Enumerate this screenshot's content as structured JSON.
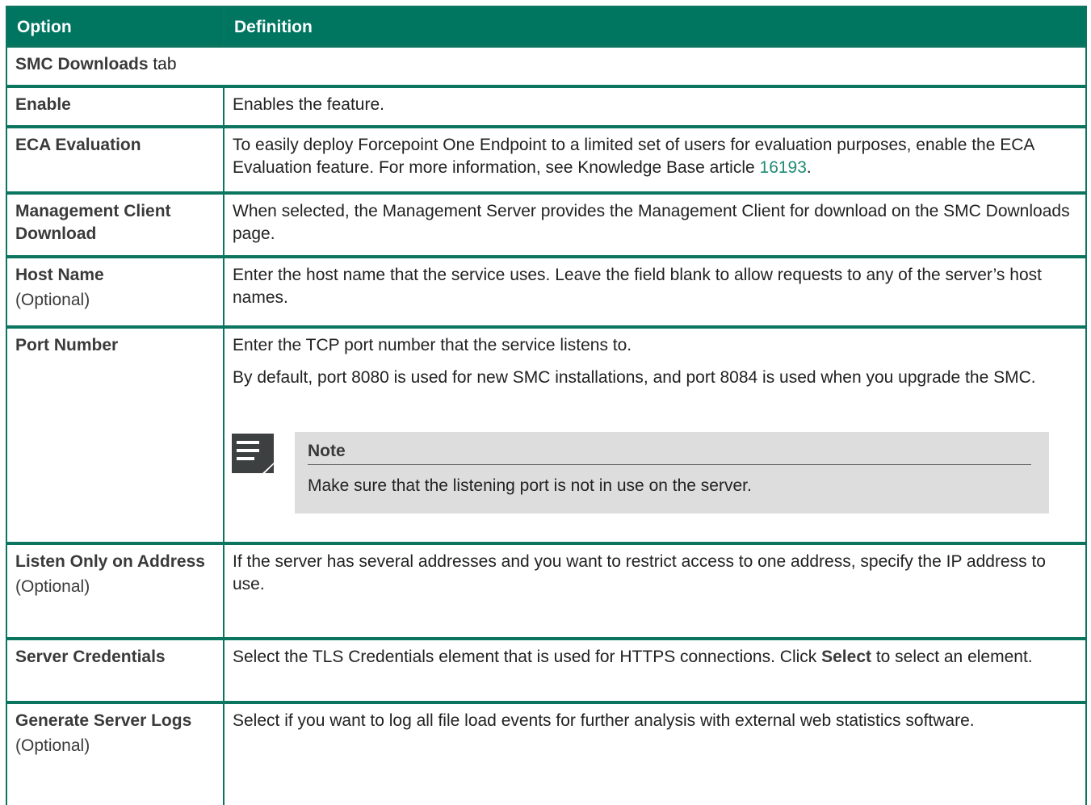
{
  "table": {
    "headers": {
      "option": "Option",
      "definition": "Definition"
    },
    "section": {
      "name": "SMC Downloads",
      "suffix": " tab"
    },
    "rows": [
      {
        "option": "Enable",
        "definition": "Enables the feature."
      },
      {
        "option": "ECA Evaluation",
        "definition_text": "To easily deploy Forcepoint One Endpoint to a limited set of users for evaluation purposes, enable the ECA Evaluation feature. For more information, see Knowledge Base article ",
        "link": "16193",
        "definition_end": "."
      },
      {
        "option": "Management Client Download",
        "definition": "When selected, the Management Server provides the Management Client for download on the SMC Downloads page."
      },
      {
        "option": "Host Name",
        "option_note": "(Optional)",
        "definition": "Enter the host name that the service uses. Leave the field blank to allow requests to any of the server’s host names."
      },
      {
        "option": "Port Number",
        "definition_p1": "Enter the TCP port number that the service listens to.",
        "definition_p2": "By default, port 8080 is used for new SMC installations, and port 8084 is used when you upgrade the SMC.",
        "note": {
          "title": "Note",
          "text": "Make sure that the listening port is not in use on the server.",
          "icon": "note-icon"
        }
      },
      {
        "option": "Listen Only on Address",
        "option_note": "(Optional)",
        "definition": "If the server has several addresses and you want to restrict access to one address, specify the IP address to use."
      },
      {
        "option": "Server Credentials",
        "definition_pre": "Select the TLS Credentials element that is used for HTTPS connections. Click ",
        "definition_bold": "Select",
        "definition_post": " to select an element."
      },
      {
        "option": "Generate Server Logs",
        "option_note": "(Optional)",
        "definition": "Select if you want to log all file load events for further analysis with external web statistics software."
      }
    ]
  },
  "colors": {
    "header_bg": "#007661",
    "border": "#0b7560",
    "link": "#1f8b73",
    "note_bg": "#dddddd"
  }
}
